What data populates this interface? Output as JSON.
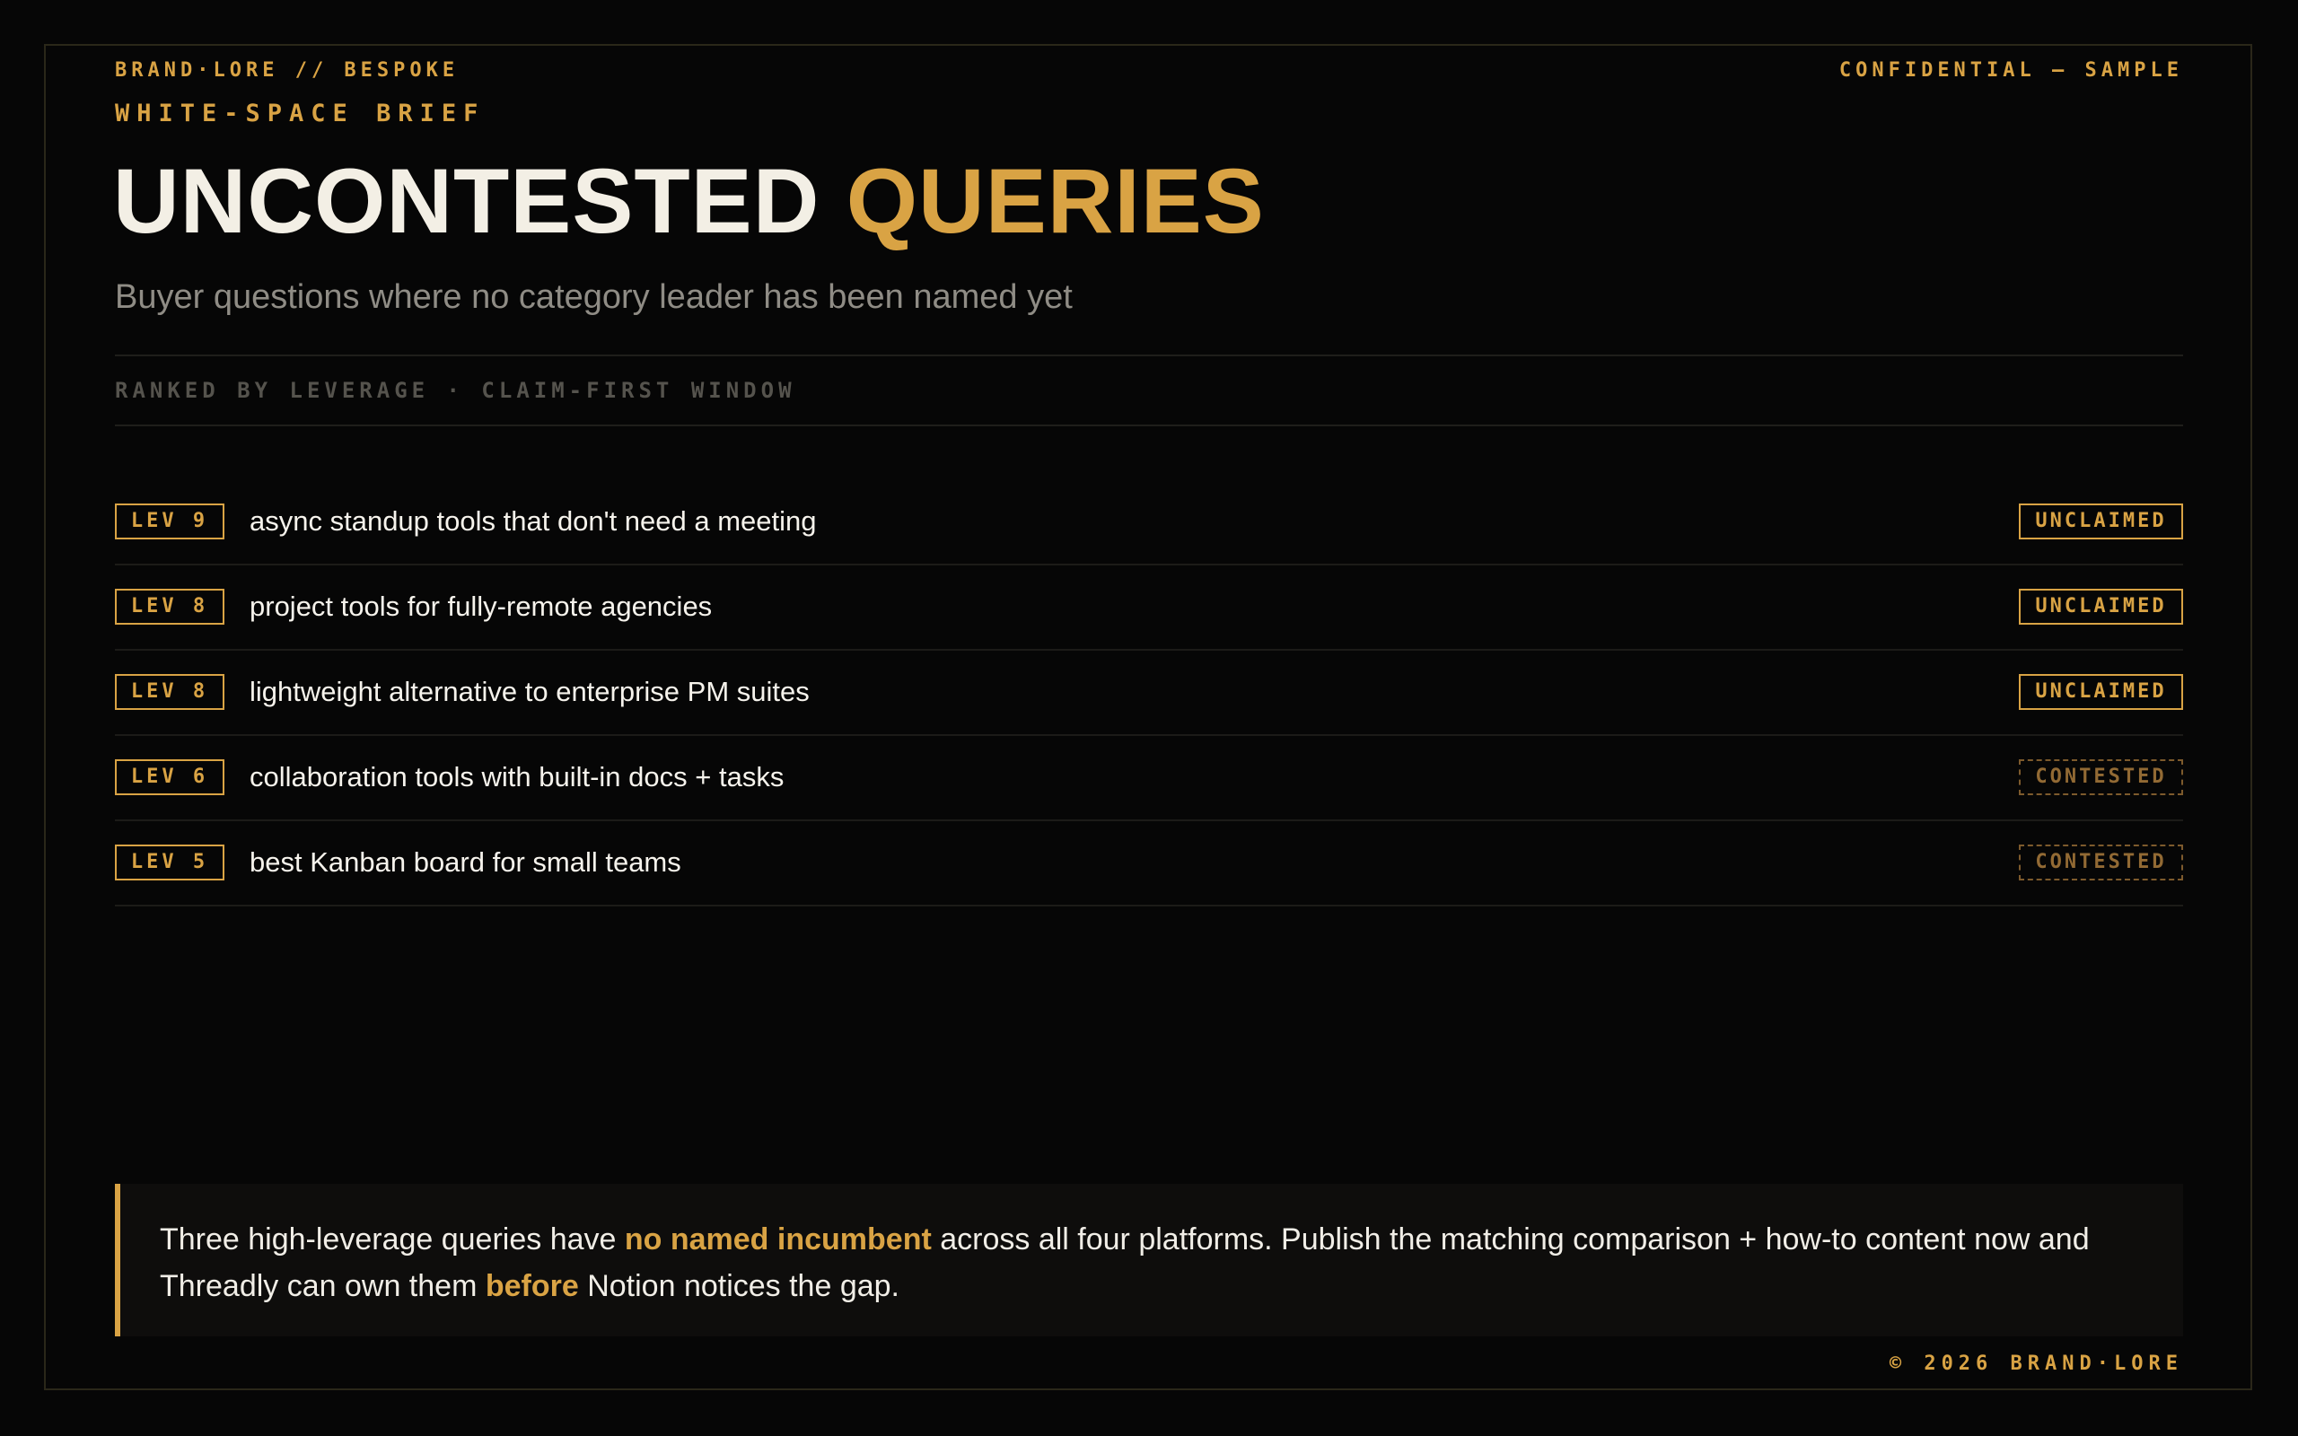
{
  "header": {
    "brand": "BRAND·LORE // BESPOKE",
    "confidential": "CONFIDENTIAL — SAMPLE",
    "eyebrow": "WHITE-SPACE BRIEF"
  },
  "title": {
    "part1": "UNCONTESTED",
    "part2": "QUERIES"
  },
  "subtitle": "Buyer questions where no category leader has been named yet",
  "ranked_label": "RANKED BY LEVERAGE · CLAIM-FIRST WINDOW",
  "queries": [
    {
      "lev": "LEV 9",
      "text": "async standup tools that don't need a meeting",
      "status": "UNCLAIMED"
    },
    {
      "lev": "LEV 8",
      "text": "project tools for fully-remote agencies",
      "status": "UNCLAIMED"
    },
    {
      "lev": "LEV 8",
      "text": "lightweight alternative to enterprise PM suites",
      "status": "UNCLAIMED"
    },
    {
      "lev": "LEV 6",
      "text": "collaboration tools with built-in docs + tasks",
      "status": "CONTESTED"
    },
    {
      "lev": "LEV 5",
      "text": "best Kanban board for small teams",
      "status": "CONTESTED"
    }
  ],
  "callout": {
    "t1": "Three high-leverage queries have ",
    "h1": "no named incumbent",
    "t2": " across all four platforms. Publish the matching comparison + how-to content now and Threadly can own them ",
    "h2": "before",
    "t3": " Notion notices the gap."
  },
  "footer": "© 2026 BRAND·LORE",
  "colors": {
    "background": "#060606",
    "accent": "#d9a344",
    "contested": "#926a34",
    "text": "#f2efe6",
    "muted": "#8f8c85"
  }
}
